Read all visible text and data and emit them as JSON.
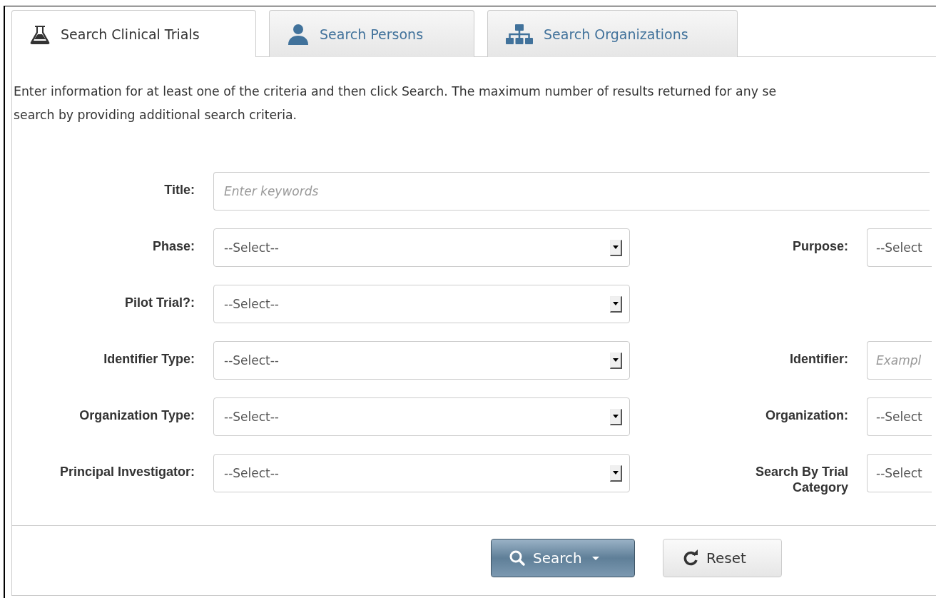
{
  "tabs": [
    {
      "label": "Search Clinical Trials",
      "selected": true
    },
    {
      "label": "Search Persons",
      "selected": false
    },
    {
      "label": "Search Organizations",
      "selected": false
    }
  ],
  "intro_lines": [
    "Enter information for at least one of the criteria and then click Search. The maximum number of results returned for any se",
    "search by providing additional search criteria."
  ],
  "title_field": {
    "label": "Title:",
    "placeholder": "Enter keywords"
  },
  "rows": [
    {
      "left": {
        "label": "Phase:",
        "kind": "select",
        "value": "--Select--"
      },
      "right": {
        "label": "Purpose:",
        "kind": "select",
        "value": "--Select"
      }
    },
    {
      "left": {
        "label": "Pilot Trial?:",
        "kind": "select",
        "value": "--Select--"
      }
    },
    {
      "left": {
        "label": "Identifier Type:",
        "kind": "select",
        "value": "--Select--"
      },
      "right": {
        "label": "Identifier:",
        "kind": "text",
        "placeholder": "Exampl"
      }
    },
    {
      "left": {
        "label": "Organization Type:",
        "kind": "select",
        "value": "--Select--"
      },
      "right": {
        "label": "Organization:",
        "kind": "select",
        "value": "--Select"
      }
    },
    {
      "left": {
        "label": "Principal Investigator:",
        "kind": "select",
        "value": "--Select--"
      },
      "right": {
        "label": "Search By Trial Category",
        "kind": "select",
        "value": "--Select"
      }
    }
  ],
  "buttons": [
    {
      "label": "Search",
      "kind": "primary",
      "dropdown": true
    },
    {
      "label": "Reset",
      "kind": "default",
      "dropdown": false
    }
  ]
}
